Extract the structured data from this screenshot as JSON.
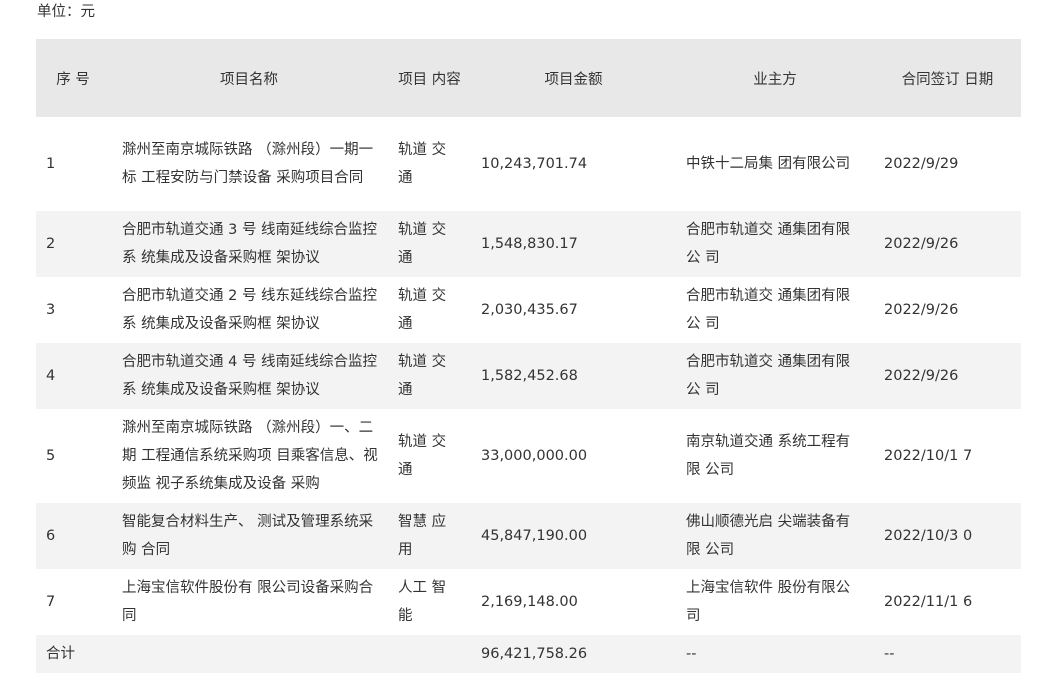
{
  "unit_label": "单位：元",
  "headers": {
    "index": "序 号",
    "name": "项目名称",
    "content": "项目 内容",
    "amount": "项目金额",
    "owner": "业主方",
    "date": "合同签订 日期"
  },
  "rows": [
    {
      "index": "1",
      "name": "滁州至南京城际铁路 （滁州段）一期一标 工程安防与门禁设备 采购项目合同",
      "content": "轨道 交通",
      "amount": "10,243,701.74",
      "owner": "中铁十二局集 团有限公司",
      "date": "2022/9/29"
    },
    {
      "index": "2",
      "name": "合肥市轨道交通 3 号 线南延线综合监控系 统集成及设备采购框 架协议",
      "content": "轨道 交通",
      "amount": "1,548,830.17",
      "owner": "合肥市轨道交 通集团有限公 司",
      "date": "2022/9/26"
    },
    {
      "index": "3",
      "name": "合肥市轨道交通 2 号 线东延线综合监控系 统集成及设备采购框 架协议",
      "content": "轨道 交通",
      "amount": "2,030,435.67",
      "owner": "合肥市轨道交 通集团有限公 司",
      "date": "2022/9/26"
    },
    {
      "index": "4",
      "name": "合肥市轨道交通 4 号 线南延线综合监控系 统集成及设备采购框 架协议",
      "content": "轨道 交通",
      "amount": "1,582,452.68",
      "owner": "合肥市轨道交 通集团有限公 司",
      "date": "2022/9/26"
    },
    {
      "index": "5",
      "name": "滁州至南京城际铁路 （滁州段）一、二期 工程通信系统采购项 目乘客信息、视频监 视子系统集成及设备 采购",
      "content": "轨道 交通",
      "amount": "33,000,000.00",
      "owner": "南京轨道交通 系统工程有限 公司",
      "date": "2022/10/1 7"
    },
    {
      "index": "6",
      "name": "智能复合材料生产、 测试及管理系统采购 合同",
      "content": "智慧 应用",
      "amount": "45,847,190.00",
      "owner": "佛山顺德光启 尖端装备有限 公司",
      "date": "2022/10/3 0"
    },
    {
      "index": "7",
      "name": "上海宝信软件股份有 限公司设备采购合同",
      "content": "人工 智能",
      "amount": "2,169,148.00",
      "owner": "上海宝信软件 股份有限公司",
      "date": "2022/11/1 6"
    }
  ],
  "total": {
    "label": "合计",
    "amount": "96,421,758.26",
    "owner": "--",
    "date": "--"
  }
}
